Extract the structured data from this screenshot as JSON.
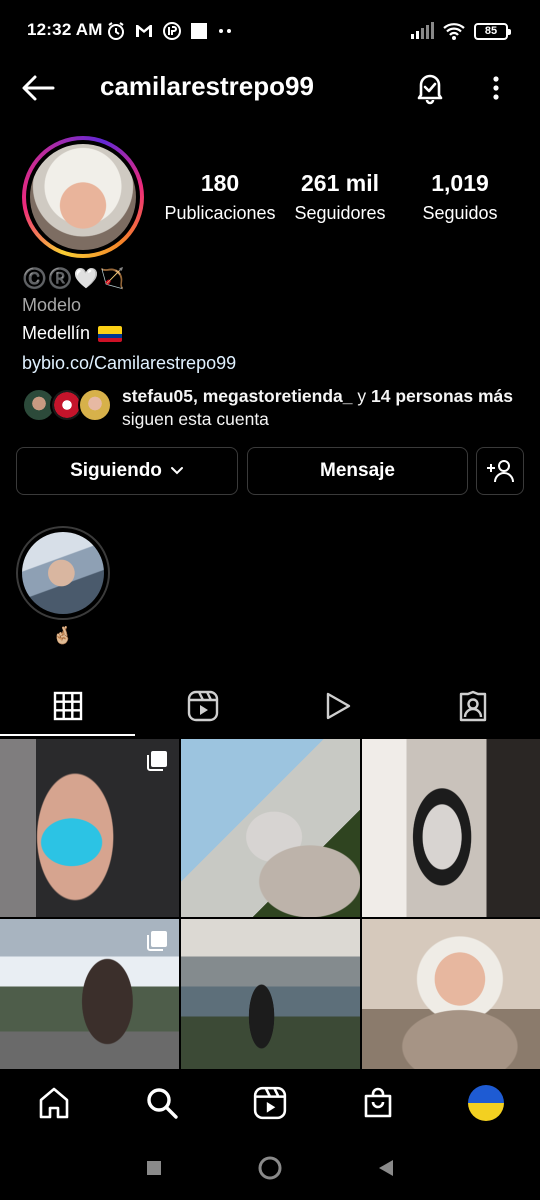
{
  "status_bar": {
    "time": "12:32 AM",
    "battery": "85",
    "icons": [
      "alarm-icon",
      "gmail-icon",
      "circle-app-icon",
      "square-icon",
      "more-dots-icon",
      "signal-icon",
      "wifi-icon",
      "battery-icon"
    ]
  },
  "header": {
    "username": "camilarestrepo99",
    "icons": [
      "back-arrow-icon",
      "notification-bell-icon",
      "more-vertical-icon"
    ]
  },
  "profile": {
    "stats": [
      {
        "value": "180",
        "label": "Publicaciones"
      },
      {
        "value": "261 mil",
        "label": "Seguidores"
      },
      {
        "value": "1,019",
        "label": "Seguidos"
      }
    ],
    "bio": {
      "emoji_line": "©️®️🤍🏹",
      "category": "Modelo",
      "location": "Medellín",
      "link": "bybio.co/Camilarestrepo99"
    },
    "followed_by": {
      "names": "stefau05, megastoretienda_",
      "connector": " y ",
      "rest_bold": "14 personas más",
      "rest": " siguen esta cuenta"
    }
  },
  "actions": {
    "following_label": "Siguiendo",
    "message_label": "Mensaje"
  },
  "highlights": [
    {
      "label": "🤞🏼"
    }
  ],
  "tabs": [
    "grid-tab",
    "reels-tab",
    "videos-tab",
    "tagged-tab"
  ],
  "colors": {
    "background": "#000000",
    "text": "#ffffff",
    "secondary_text": "#a8a8a8",
    "button_border": "#3a3a3a",
    "story_ring": [
      "#f9ce34",
      "#ee2a7b",
      "#6228d7"
    ]
  }
}
